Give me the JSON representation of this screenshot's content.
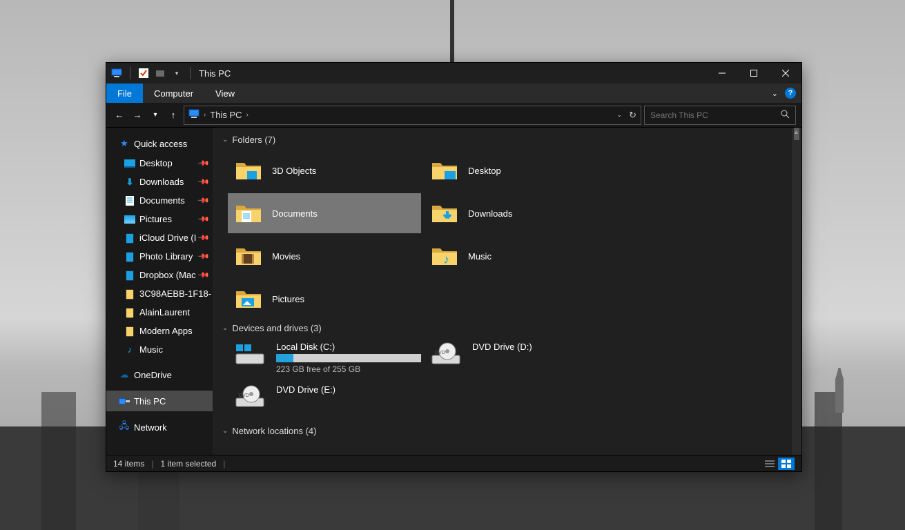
{
  "titlebar": {
    "title": "This PC"
  },
  "menubar": {
    "file": "File",
    "computer": "Computer",
    "view": "View",
    "help": "?"
  },
  "address": {
    "location": "This PC",
    "chevron": "›"
  },
  "search": {
    "placeholder": "Search This PC"
  },
  "sidebar": {
    "quick_access": "Quick access",
    "items": [
      {
        "label": "Desktop"
      },
      {
        "label": "Downloads"
      },
      {
        "label": "Documents"
      },
      {
        "label": "Pictures"
      },
      {
        "label": "iCloud Drive (I"
      },
      {
        "label": "Photo Library"
      },
      {
        "label": "Dropbox (Mac"
      },
      {
        "label": "3C98AEBB-1F18-"
      },
      {
        "label": "AlainLaurent"
      },
      {
        "label": "Modern Apps"
      },
      {
        "label": "Music"
      }
    ],
    "onedrive": "OneDrive",
    "this_pc": "This PC",
    "network": "Network"
  },
  "groups": {
    "folders": {
      "label": "Folders (7)",
      "items": [
        {
          "label": "3D Objects"
        },
        {
          "label": "Desktop"
        },
        {
          "label": "Documents"
        },
        {
          "label": "Downloads"
        },
        {
          "label": "Movies"
        },
        {
          "label": "Music"
        },
        {
          "label": "Pictures"
        }
      ]
    },
    "drives": {
      "label": "Devices and drives (3)",
      "local": {
        "label": "Local Disk (C:)",
        "free": "223 GB free of 255 GB",
        "used_pct": 12
      },
      "dvd_d": {
        "label": "DVD Drive (D:)"
      },
      "dvd_e": {
        "label": "DVD Drive (E:)"
      }
    },
    "network": {
      "label": "Network locations (4)"
    }
  },
  "statusbar": {
    "items": "14 items",
    "selected": "1 item selected"
  }
}
